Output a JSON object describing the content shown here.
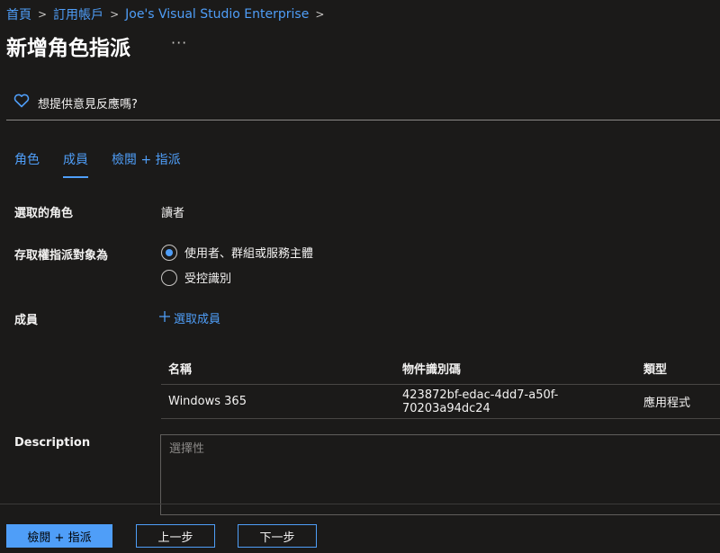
{
  "breadcrumb": [
    "首頁",
    "訂用帳戶",
    "Joe's Visual Studio Enterprise"
  ],
  "page_title": "新增角色指派",
  "more_label": "···",
  "feedback": {
    "label": "想提供意見反應嗎?",
    "icon": "heart-icon"
  },
  "tabs": [
    {
      "label": "角色",
      "active": false
    },
    {
      "label": "成員",
      "active": true
    },
    {
      "label": "檢閱 + 指派",
      "active": false
    }
  ],
  "form": {
    "selected_role": {
      "label": "選取的角色",
      "value": "讀者"
    },
    "assign_access_to": {
      "label": "存取權指派對象為",
      "options": [
        {
          "label": "使用者、群組或服務主體",
          "selected": true
        },
        {
          "label": "受控識別",
          "selected": false
        }
      ]
    },
    "members": {
      "label": "成員",
      "select_link": "選取成員"
    },
    "table": {
      "headers": [
        "名稱",
        "物件識別碼",
        "類型"
      ],
      "rows": [
        {
          "name": "Windows 365",
          "object_id": "423872bf-edac-4dd7-a50f-70203a94dc24",
          "type": "應用程式"
        }
      ]
    },
    "description": {
      "label": "Description",
      "placeholder": "選擇性"
    }
  },
  "footer": {
    "review_assign": "檢閱 + 指派",
    "previous": "上一步",
    "next": "下一步"
  },
  "colors": {
    "accent": "#4f9ef8",
    "background": "#1b1a19"
  }
}
